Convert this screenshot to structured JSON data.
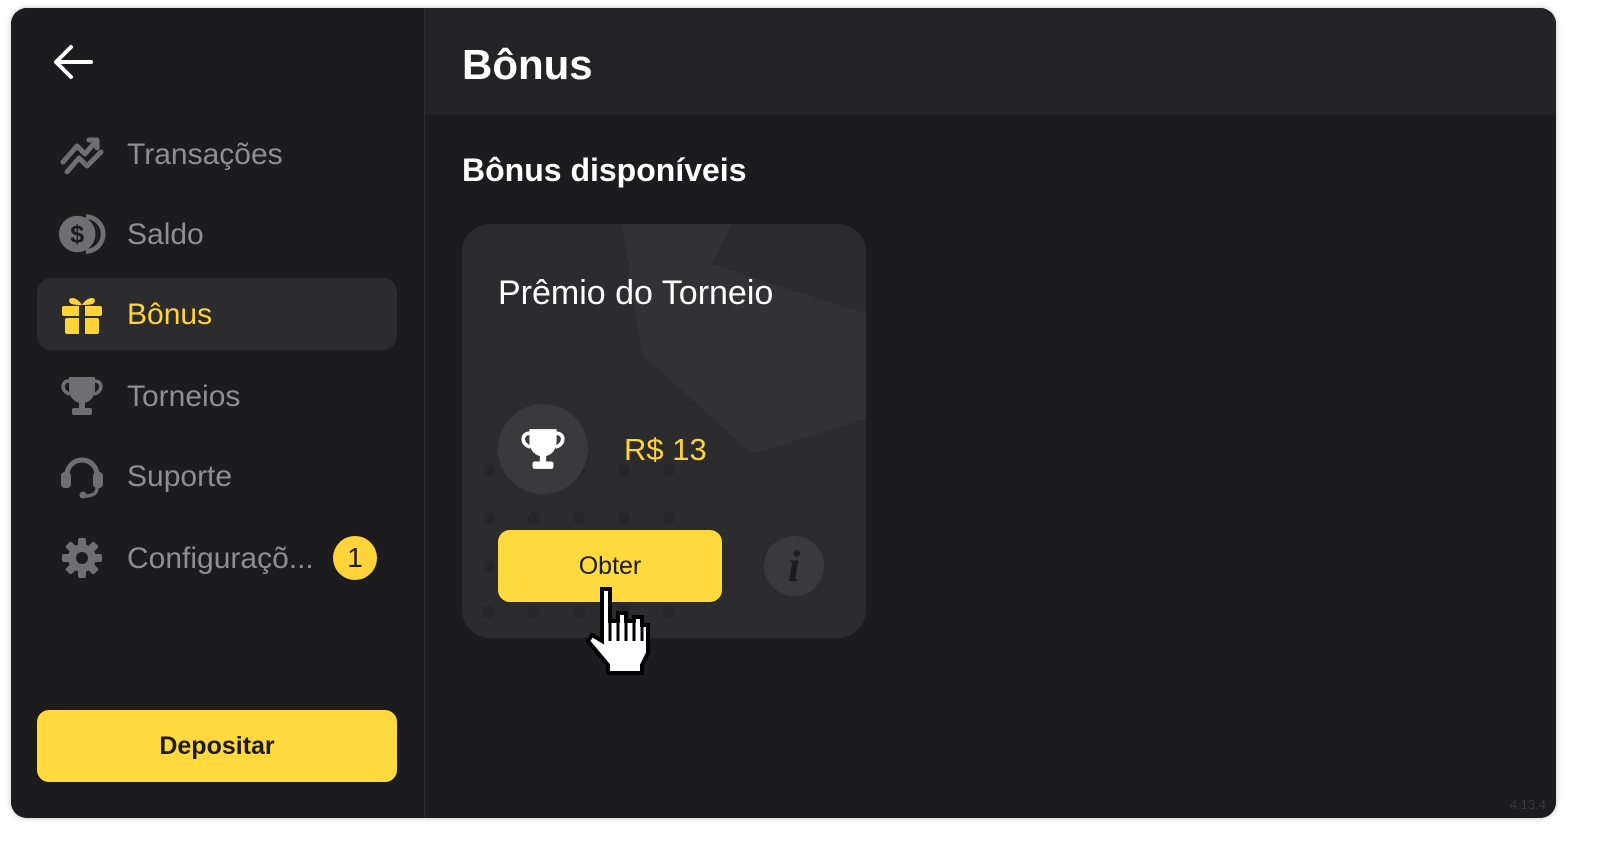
{
  "sidebar": {
    "back_icon": "arrow-left-icon",
    "items": [
      {
        "label": "Transações",
        "icon": "transactions-icon"
      },
      {
        "label": "Saldo",
        "icon": "coins-icon"
      },
      {
        "label": "Bônus",
        "icon": "gift-icon",
        "active": true
      },
      {
        "label": "Torneios",
        "icon": "trophy-icon"
      },
      {
        "label": "Suporte",
        "icon": "headset-icon"
      },
      {
        "label": "Configuraçõ...",
        "icon": "gear-icon",
        "badge": "1"
      }
    ],
    "deposit_label": "Depositar"
  },
  "header": {
    "title": "Bônus"
  },
  "main": {
    "section_title": "Bônus disponíveis",
    "bonus_card": {
      "title": "Prêmio do Torneio",
      "amount": "R$ 13",
      "claim_label": "Obter",
      "info_glyph": "i"
    }
  },
  "version": "4.13.4",
  "colors": {
    "accent": "#ffd93d",
    "background": "#1c1c1e",
    "card": "#2c2c2e",
    "muted_text": "#8e8e93"
  }
}
